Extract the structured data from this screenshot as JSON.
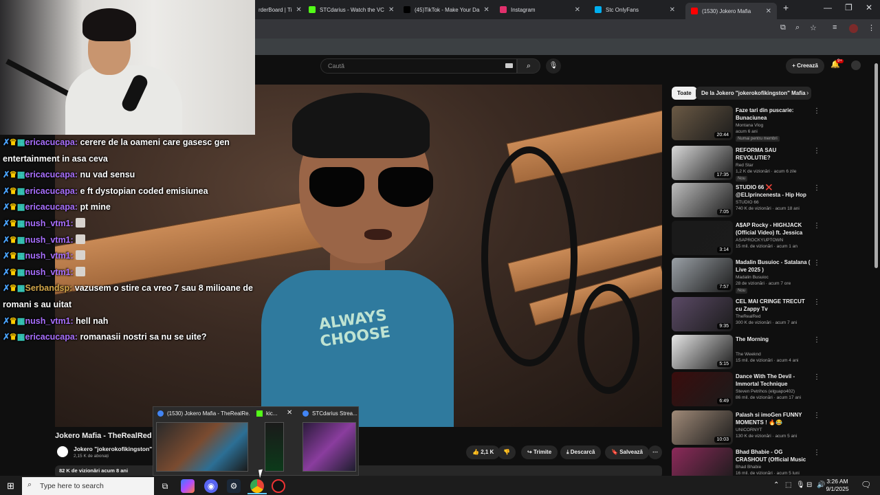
{
  "browser": {
    "tabs": [
      {
        "label": "rderBoard | Ti",
        "color": "#555555"
      },
      {
        "label": "STCdarius - Watch the VC",
        "color": "#53fc18"
      },
      {
        "label": "(45)TikTok - Make Your Da",
        "color": "#000000"
      },
      {
        "label": "Instagram",
        "color": "#e1306c"
      },
      {
        "label": "Stc OnlyFans",
        "color": "#00aff0"
      },
      {
        "label": "(1530) Jokero Mafia",
        "color": "#ff0000"
      }
    ],
    "new_tab": "+",
    "minimize": "—",
    "restore": "❐",
    "close": "✕"
  },
  "youtube": {
    "search_placeholder": "Caută",
    "create_label": "+ Creează",
    "notif_count": "9+",
    "chips": [
      "Toate",
      "De la Jokero \"jokerokofikingston\" Mafia"
    ],
    "video_title": "Jokero Mafia - TheRealRed su",
    "channel_name": "Jokero \"jokerokofikingston\" M",
    "subscribers": "2,15 K de abonați",
    "likes": "2,1 K",
    "share": "Trimite",
    "download": "Descarcă",
    "save": "Salvează",
    "more": "⋯",
    "views_date": "82 K de vizionări  acum 8 ani",
    "shirt_text": "ALWAYS CHOOSE"
  },
  "recommendations": [
    {
      "title": "Faze tari din puscarie: Bunaciunea",
      "channel": "Montana Vlog",
      "meta": "acum 6 ani",
      "tag": "Numai pentru membri",
      "duration": "20:44",
      "color": "#6b5a45"
    },
    {
      "title": "REFORMA SAU REVOLUTIE?",
      "channel": "Red Star",
      "meta": "1,2 K de vizionări · acum 6 zile",
      "tag": "Nou",
      "duration": "17:35",
      "color": "#d8d8d8"
    },
    {
      "title": "STUDIO 66 ❌ @ELIprincenesta - Hip Hop De Timisoara 2",
      "channel": "STUDIO 66",
      "meta": "740 K de vizionări · acum 18 ani",
      "tag": "",
      "duration": "7:05",
      "color": "#bdbdbd"
    },
    {
      "title": "A$AP Rocky - HIGHJACK (Official Video) ft. Jessica Pratt",
      "channel": "ASAPROCKYUPTOWN",
      "meta": "15 mil. de vizionări · acum 1 an",
      "tag": "",
      "duration": "3:14",
      "color": "#1a1a1a"
    },
    {
      "title": "Madalin Busuioc - Satalana ( Live 2025 )",
      "channel": "Madalin Busuioc",
      "meta": "28 de vizionări · acum 7 ore",
      "tag": "Nou",
      "duration": "7:57",
      "color": "#9aa0a6"
    },
    {
      "title": "CEL MAI CRINGE TRECUT cu Zappy Tv",
      "channel": "TheRealRed",
      "meta": "300 K de vizionări · acum 7 ani",
      "tag": "",
      "duration": "9:35",
      "color": "#5b4a66"
    },
    {
      "title": "The Morning",
      "channel": "The Weeknd",
      "meta": "15 mil. de vizionări · acum 4 ani",
      "tag": "",
      "duration": "5:15",
      "color": "#e6e6e6"
    },
    {
      "title": "Dance With The Devil - Immortal Technique",
      "channel": "Steven Petrihos (elguapo402)",
      "meta": "86 mil. de vizionări · acum 17 ani",
      "tag": "",
      "duration": "6:49",
      "color": "#3a0d0d"
    },
    {
      "title": "Palash si imoGen FUNNY MOMENTS ! 🔥😂",
      "channel": "UNICORNYT",
      "meta": "130 K de vizionări · acum 5 ani",
      "tag": "",
      "duration": "10:03",
      "color": "#a08a78"
    },
    {
      "title": "Bhad Bhabie - OG CRASHOUT (Official Music Video)",
      "channel": "Bhad Bhabie",
      "meta": "16 mil. de vizionări · acum 5 luni",
      "tag": "",
      "duration": "",
      "color": "#8c2a5a"
    }
  ],
  "chat": [
    {
      "user": "ericacucapa",
      "text": "cerere de la oameni care gasesc gen entertainment in asa ceva",
      "color": "#a970ff",
      "emote": false
    },
    {
      "user": "ericacucapa",
      "text": "nu vad sensu",
      "color": "#a970ff",
      "emote": false
    },
    {
      "user": "ericacucapa",
      "text": "e ft dystopian coded emisiunea",
      "color": "#a970ff",
      "emote": false
    },
    {
      "user": "ericacucapa",
      "text": "pt mine",
      "color": "#a970ff",
      "emote": false
    },
    {
      "user": "nush_vtm1",
      "text": "",
      "color": "#a970ff",
      "emote": true
    },
    {
      "user": "nush_vtm1",
      "text": "",
      "color": "#a970ff",
      "emote": true
    },
    {
      "user": "nush_vtm1",
      "text": "",
      "color": "#a970ff",
      "emote": true
    },
    {
      "user": "nush_vtm1",
      "text": "",
      "color": "#a970ff",
      "emote": true
    },
    {
      "user": "Serbandsp",
      "text": "vazusem o stire ca vreo 7 sau 8 milioane de romani s au uitat",
      "color": "#d4a84a",
      "emote": false
    },
    {
      "user": "nush_vtm1",
      "text": "hell nah",
      "color": "#a970ff",
      "emote": false
    },
    {
      "user": "ericacucapa",
      "text": "romanasii nostri sa nu se uite?",
      "color": "#a970ff",
      "emote": false
    }
  ],
  "preview": {
    "items": [
      "(1530) Jokero Mafia - TheRealRe...",
      "kic...",
      "STCdarius Strea..."
    ]
  },
  "taskbar": {
    "search_placeholder": "Type here to search",
    "time": "3:26 AM",
    "date": "9/1/2025"
  }
}
